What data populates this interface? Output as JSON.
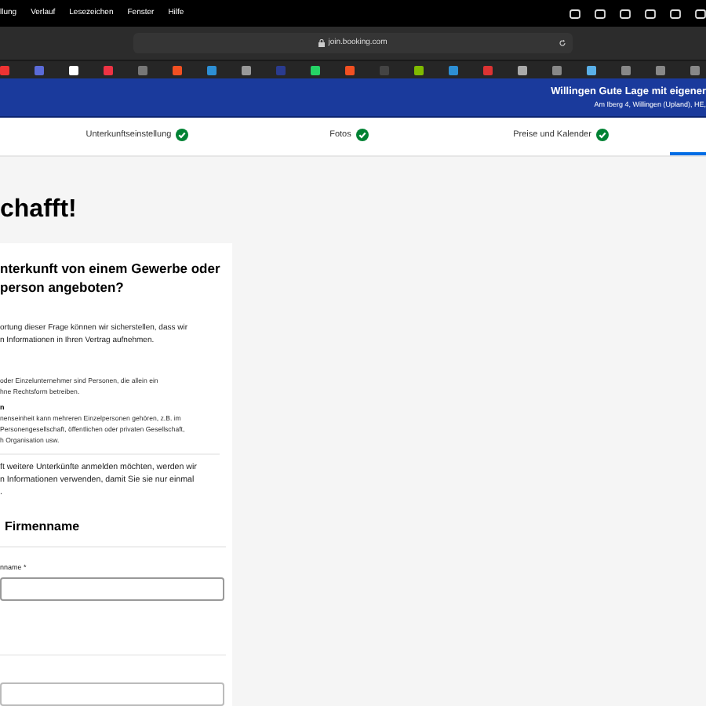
{
  "menu_bar": [
    "llung",
    "Verlauf",
    "Lesezeichen",
    "Fenster",
    "Hilfe"
  ],
  "address_bar": {
    "url": "join.booking.com"
  },
  "header": {
    "title": "Willingen Gute Lage mit eigener",
    "address": "Am Iberg 4, Willingen (Upland), HE,"
  },
  "steps": [
    {
      "label": "Unterkunftseinstellung",
      "done": true,
      "selected": false
    },
    {
      "label": "Fotos",
      "done": true,
      "selected": false
    },
    {
      "label": "Preise und Kalender",
      "done": true,
      "selected": false
    },
    {
      "done": false,
      "selected": true
    }
  ],
  "page_title": "chafft!",
  "card": {
    "heading": [
      "nterkunft von einem Gewerbe oder",
      "person angeboten?"
    ],
    "intro": [
      "ortung dieser Frage können wir sicherstellen, dass wir",
      "n Informationen in Ihren Vertrag aufnehmen."
    ],
    "option_1": [
      "oder Einzelunternehmer sind Personen, die allein ein",
      "hne Rechtsform betreiben."
    ],
    "option_2_label": "n",
    "option_2": [
      "nenseinheit kann mehreren Einzelpersonen gehören, z.B. im",
      "Personengesellschaft, öffentlichen oder privaten Gesellschaft,",
      "h Organisation usw."
    ],
    "note": [
      "ft weitere Unterkünfte anmelden möchten, werden wir",
      "n Informationen verwenden, damit Sie sie nur einmal",
      "."
    ],
    "section_title": "Firmenname",
    "field_label": "nname *"
  }
}
